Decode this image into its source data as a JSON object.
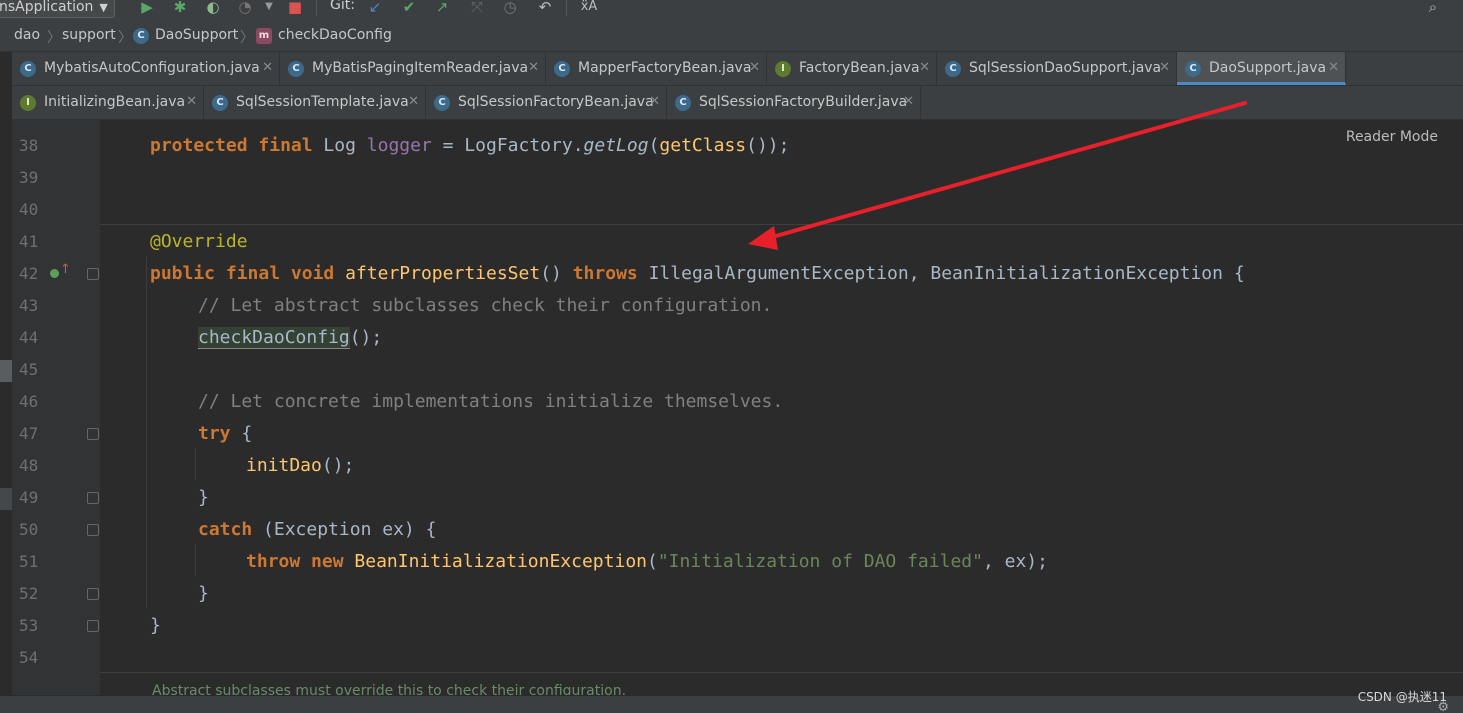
{
  "toolbar": {
    "run_config": "nsApplication",
    "git_label": "Git:",
    "icons": [
      "run-icon",
      "debug-icon",
      "coverage-icon",
      "profile-icon",
      "stop-icon",
      "git-update-icon",
      "git-commit-icon",
      "git-push-icon",
      "history-icon",
      "rollback-icon",
      "translate-icon",
      "search-icon"
    ]
  },
  "breadcrumb": {
    "items": [
      "dao",
      "support",
      "DaoSupport",
      "checkDaoConfig"
    ]
  },
  "tabs_row1": [
    {
      "label": "MybatisAutoConfiguration.java",
      "icon": "class-icon",
      "active": false
    },
    {
      "label": "MyBatisPagingItemReader.java",
      "icon": "class-icon",
      "active": false
    },
    {
      "label": "MapperFactoryBean.java",
      "icon": "class-icon",
      "active": false
    },
    {
      "label": "FactoryBean.java",
      "icon": "interface-icon",
      "active": false
    },
    {
      "label": "SqlSessionDaoSupport.java",
      "icon": "class-icon",
      "active": false
    },
    {
      "label": "DaoSupport.java",
      "icon": "class-icon",
      "active": true
    }
  ],
  "tabs_row2": [
    {
      "label": "InitializingBean.java",
      "icon": "interface-icon",
      "active": false
    },
    {
      "label": "SqlSessionTemplate.java",
      "icon": "class-icon",
      "active": false
    },
    {
      "label": "SqlSessionFactoryBean.java",
      "icon": "class-icon",
      "active": false
    },
    {
      "label": "SqlSessionFactoryBuilder.java",
      "icon": "class-icon",
      "active": false
    }
  ],
  "editor": {
    "reader_mode": "Reader Mode",
    "line_numbers": [
      "38",
      "39",
      "40",
      "41",
      "42",
      "43",
      "44",
      "45",
      "46",
      "47",
      "48",
      "49",
      "50",
      "51",
      "52",
      "53",
      "54"
    ],
    "tokens": {
      "l38_protected": "protected",
      "l38_final": "final",
      "l38_log": "Log",
      "l38_logger": "logger",
      "l38_eq": " = ",
      "l38_factory": "LogFactory.",
      "l38_getlog": "getLog",
      "l38_open": "(",
      "l38_getclass": "getClass",
      "l38_close": "());",
      "l41_annotation": "@Override",
      "l42_public": "public",
      "l42_final": "final",
      "l42_void": "void",
      "l42_method": "afterPropertiesSet",
      "l42_parens": "()",
      "l42_throws": "throws",
      "l42_ex1": "IllegalArgumentException",
      "l42_comma": ", ",
      "l42_ex2": "BeanInitializationException",
      "l42_brace": " {",
      "l43_comment": "// Let abstract subclasses check their configuration.",
      "l44_call": "checkDaoConfig",
      "l44_rest": "();",
      "l46_comment": "// Let concrete implementations initialize themselves.",
      "l47_try": "try",
      "l47_brace": " {",
      "l48_call": "initDao",
      "l48_rest": "();",
      "l49_brace": "}",
      "l50_catch": "catch",
      "l50_mid": " (",
      "l50_type": "Exception",
      "l50_rest": " ex) {",
      "l51_throw": "throw",
      "l51_new": "new",
      "l51_ctor": "BeanInitializationException",
      "l51_open": "(",
      "l51_str": "\"Initialization of DAO failed\"",
      "l51_rest": ", ex);",
      "l52_brace": "}",
      "l53_brace": "}"
    },
    "doc_hint": "Abstract subclasses must override this to check their configuration."
  },
  "statusbar": {
    "watermark": "CSDN @执迷11"
  },
  "colors": {
    "keyword": "#cc7832",
    "annotation": "#bbb529",
    "comment": "#808080",
    "string": "#6a8759",
    "method": "#ffc66d",
    "field": "#9876aa",
    "arrow": "#e8202a",
    "active_tab_underline": "#4a88c7"
  }
}
